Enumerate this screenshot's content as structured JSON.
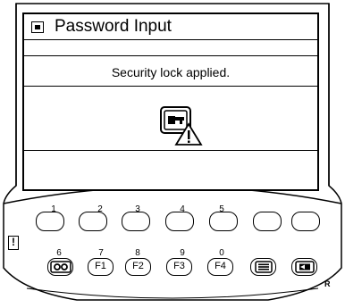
{
  "window": {
    "title": "Password Input",
    "title_icon": "lock-icon"
  },
  "message": "Security lock applied.",
  "status_icon": "key-warning-icon",
  "softkeys": [
    {
      "number": "1"
    },
    {
      "number": "2"
    },
    {
      "number": "3"
    },
    {
      "number": "4"
    },
    {
      "number": "5"
    },
    {
      "number": ""
    },
    {
      "number": ""
    }
  ],
  "function_keys": [
    {
      "number": "6",
      "label": "",
      "icon": "oo-icon"
    },
    {
      "number": "7",
      "label": "F1"
    },
    {
      "number": "8",
      "label": "F2"
    },
    {
      "number": "9",
      "label": "F3"
    },
    {
      "number": "0",
      "label": "F4"
    },
    {
      "number": "",
      "label": "",
      "icon": "menu-list-icon"
    },
    {
      "number": "",
      "label": "",
      "icon": "display-switch-icon"
    }
  ],
  "alert_indicator": "!",
  "release_label": "R"
}
